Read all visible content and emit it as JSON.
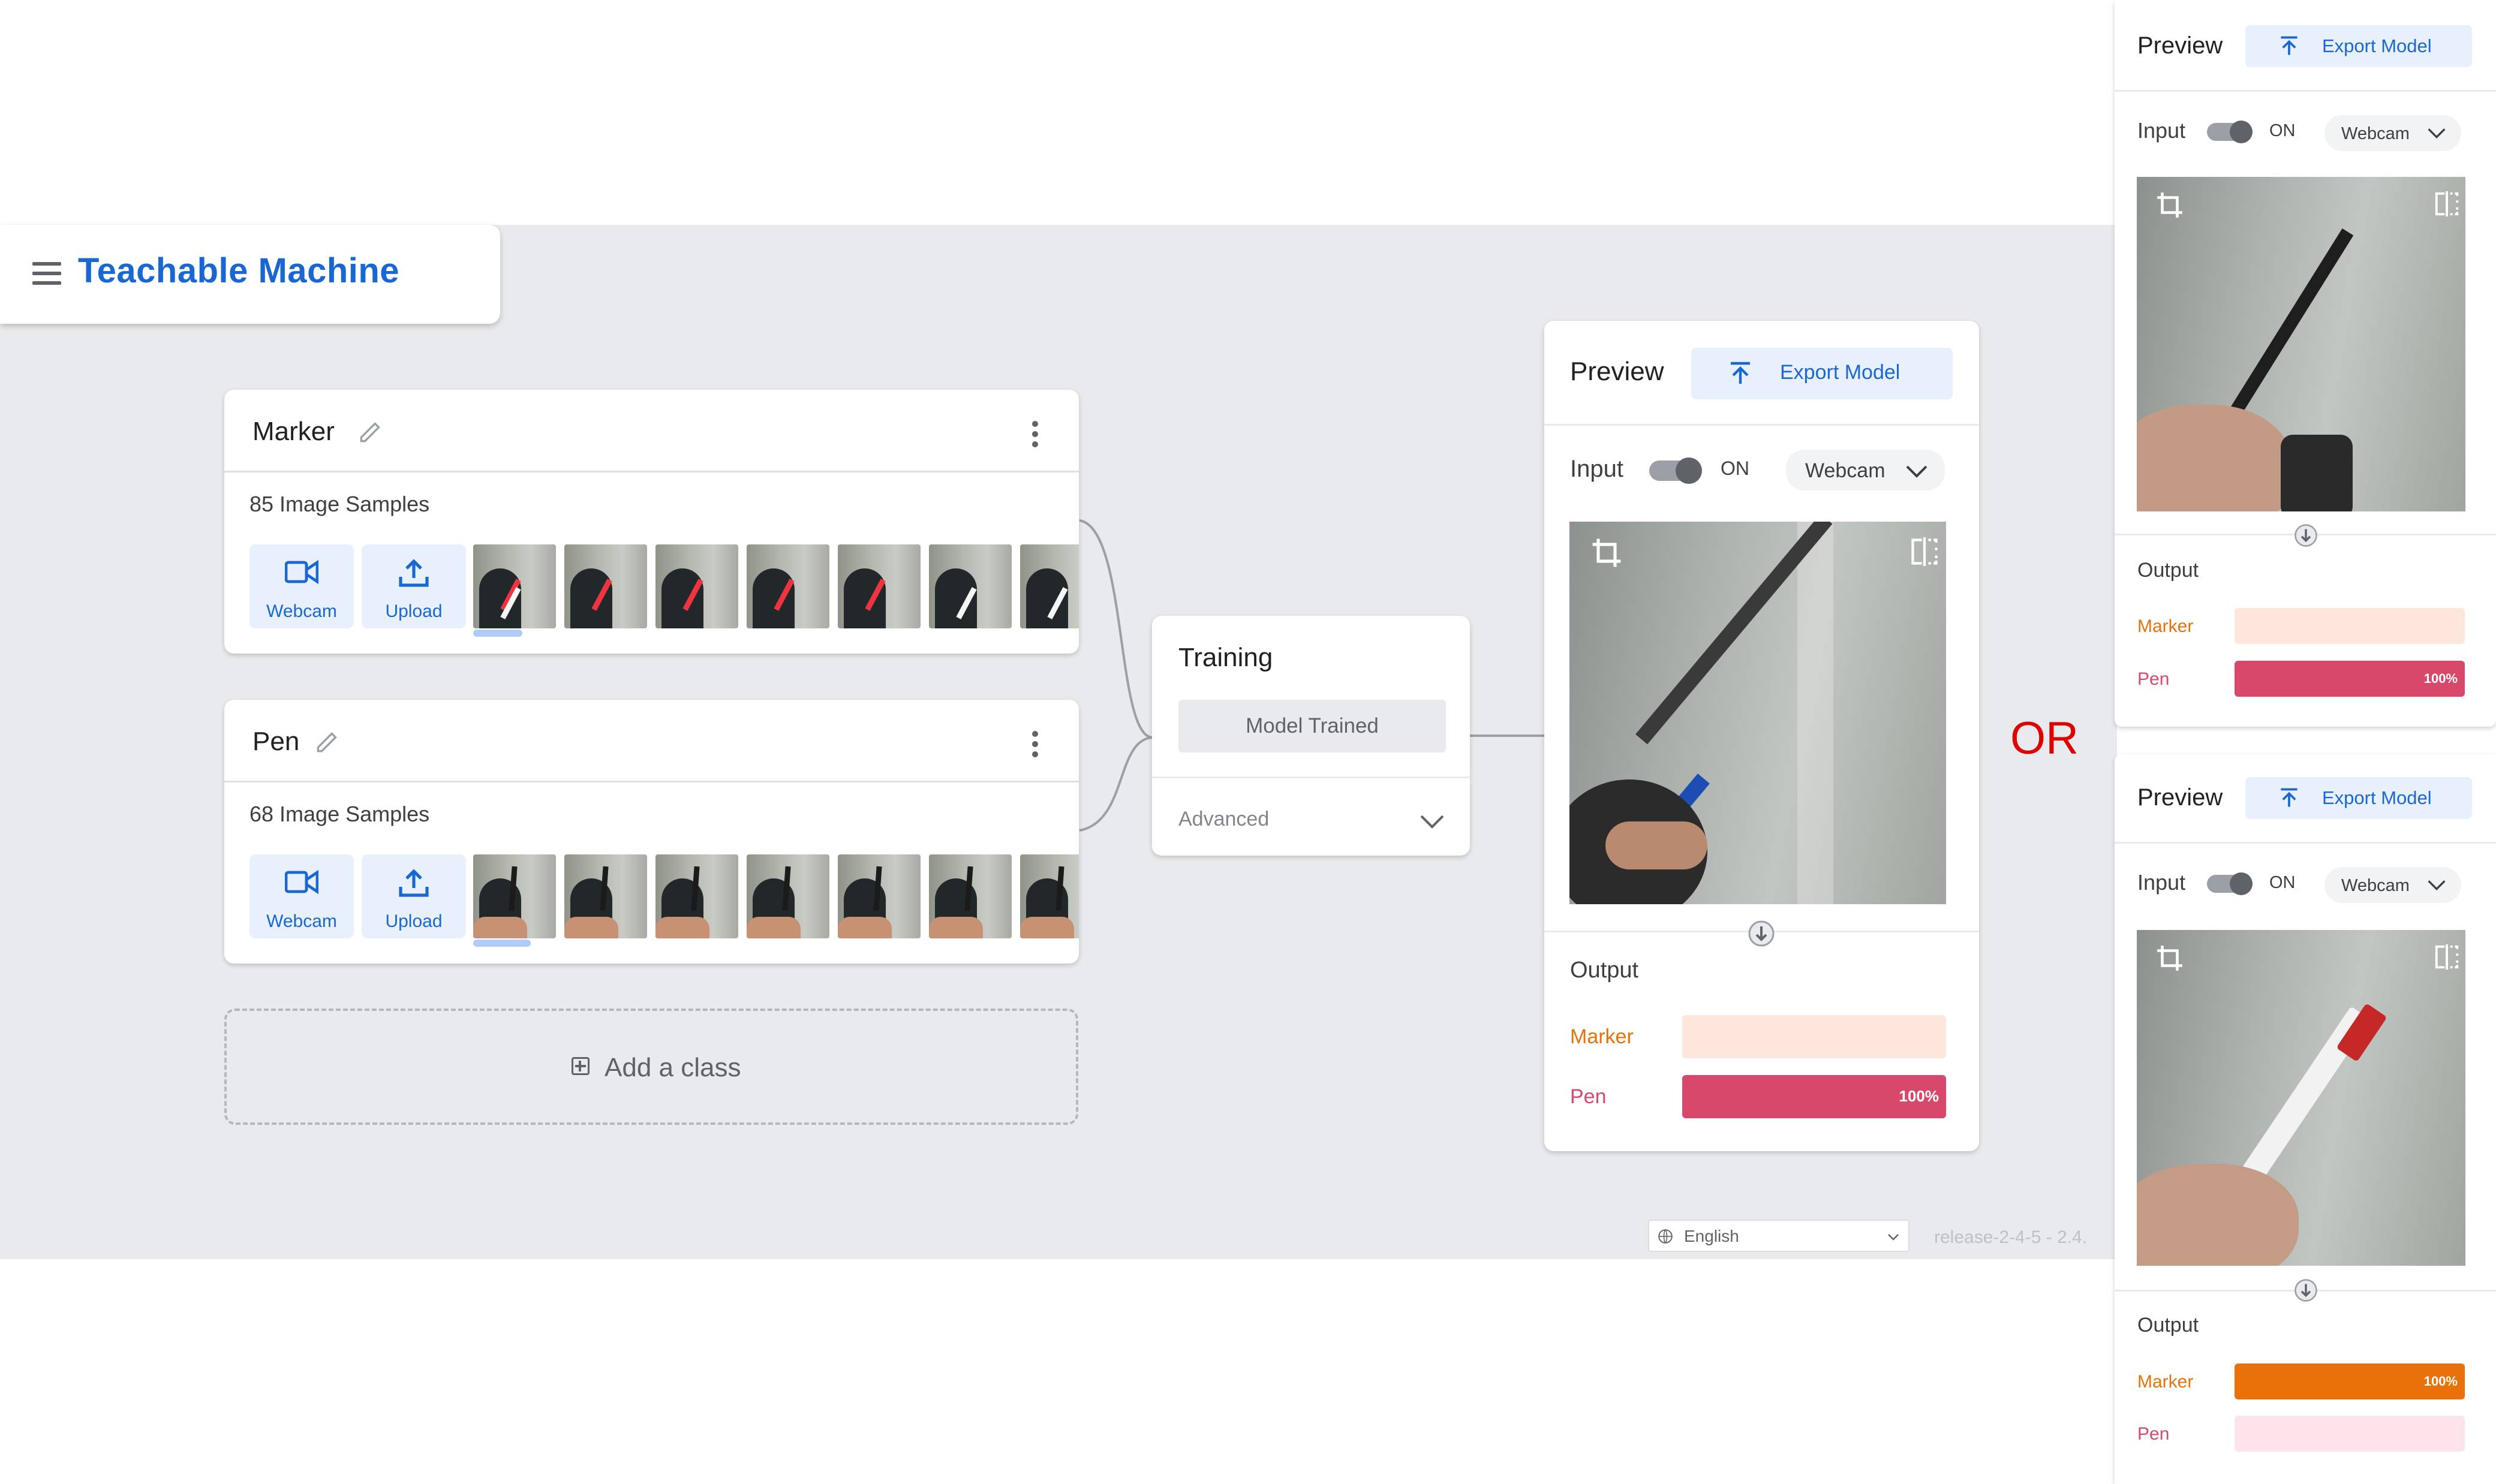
{
  "app": {
    "title": "Teachable Machine"
  },
  "classes": [
    {
      "name": "Marker",
      "samples": "85 Image Samples",
      "webcam": "Webcam",
      "upload": "Upload"
    },
    {
      "name": "Pen",
      "samples": "68 Image Samples",
      "webcam": "Webcam",
      "upload": "Upload"
    }
  ],
  "add_class": "Add a class",
  "training": {
    "title": "Training",
    "button": "Model Trained",
    "advanced": "Advanced"
  },
  "preview_main": {
    "title": "Preview",
    "export": "Export Model",
    "input_label": "Input",
    "toggle": "ON",
    "source": "Webcam",
    "output_label": "Output",
    "outputs": [
      {
        "label": "Marker",
        "value": 0,
        "display": ""
      },
      {
        "label": "Pen",
        "value": 1.0,
        "display": "100%"
      }
    ]
  },
  "preview_top": {
    "title": "Preview",
    "export": "Export Model",
    "input_label": "Input",
    "toggle": "ON",
    "source": "Webcam",
    "output_label": "Output",
    "outputs": [
      {
        "label": "Marker",
        "value": 0,
        "display": ""
      },
      {
        "label": "Pen",
        "value": 1.0,
        "display": "100%"
      }
    ]
  },
  "preview_bottom": {
    "title": "Preview",
    "export": "Export Model",
    "input_label": "Input",
    "toggle": "ON",
    "source": "Webcam",
    "output_label": "Output",
    "outputs": [
      {
        "label": "Marker",
        "value": 1.0,
        "display": "100%"
      },
      {
        "label": "Pen",
        "value": 0,
        "display": ""
      }
    ]
  },
  "or_label": "OR",
  "footer": {
    "language": "English",
    "release": "release-2-4-5 - 2.4."
  },
  "colors": {
    "brand": "#1967d2",
    "marker": "#e8710a",
    "marker_light": "#fde7dc",
    "pen": "#d7486b",
    "pen_light": "#fce4ea",
    "or": "#e00000"
  },
  "icons": [
    "menu-icon",
    "pencil-icon",
    "more-vert-icon",
    "video-camera-icon",
    "upload-icon",
    "export-upload-icon",
    "chevron-down-icon",
    "crop-icon",
    "flip-icon",
    "arrow-down-circle-icon",
    "add-box-icon",
    "globe-icon"
  ]
}
